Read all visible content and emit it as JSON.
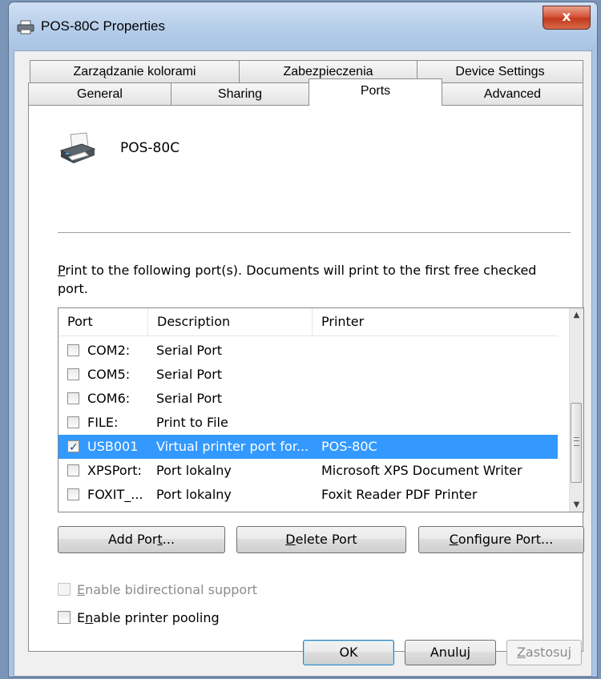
{
  "window": {
    "title": "POS-80C Properties",
    "close_glyph": "x"
  },
  "tabs": {
    "row1": [
      "Zarządzanie kolorami",
      "Zabezpieczenia",
      "Device Settings"
    ],
    "row2": [
      "General",
      "Sharing",
      "Ports",
      "Advanced"
    ],
    "active": "Ports"
  },
  "printer": {
    "name": "POS-80C",
    "icon": "printer-icon"
  },
  "ports": {
    "description": "Print to the following port(s). Documents will print to the first free checked port.",
    "columns": [
      "Port",
      "Description",
      "Printer"
    ],
    "rows": [
      {
        "checked": false,
        "port": "COM2:",
        "description": "Serial Port",
        "printer": ""
      },
      {
        "checked": false,
        "port": "COM5:",
        "description": "Serial Port",
        "printer": ""
      },
      {
        "checked": false,
        "port": "COM6:",
        "description": "Serial Port",
        "printer": ""
      },
      {
        "checked": false,
        "port": "FILE:",
        "description": "Print to File",
        "printer": ""
      },
      {
        "checked": true,
        "selected": true,
        "port": "USB001",
        "description": "Virtual printer port for...",
        "printer": "POS-80C"
      },
      {
        "checked": false,
        "port": "XPSPort:",
        "description": "Port lokalny",
        "printer": "Microsoft XPS Document Writer"
      },
      {
        "checked": false,
        "port": "FOXIT_...",
        "description": "Port lokalny",
        "printer": "Foxit Reader PDF Printer"
      }
    ],
    "scroll_up_glyph": "▲",
    "scroll_down_glyph": "▼"
  },
  "buttons": {
    "add_port": {
      "pre": "Add Por",
      "u": "t",
      "post": "..."
    },
    "delete_port": {
      "pre": "",
      "u": "D",
      "post": "elete Port"
    },
    "configure_port": {
      "pre": "",
      "u": "C",
      "post": "onfigure Port..."
    }
  },
  "options": {
    "bidirectional": {
      "pre": "",
      "u": "E",
      "post": "nable bidirectional support",
      "checked": false,
      "disabled": true
    },
    "pooling": {
      "pre": "E",
      "u": "n",
      "post": "able printer pooling",
      "checked": false,
      "disabled": false
    }
  },
  "footer": {
    "ok": "OK",
    "cancel": "Anuluj",
    "apply": {
      "pre": "",
      "u": "Z",
      "post": "astosuj"
    }
  }
}
